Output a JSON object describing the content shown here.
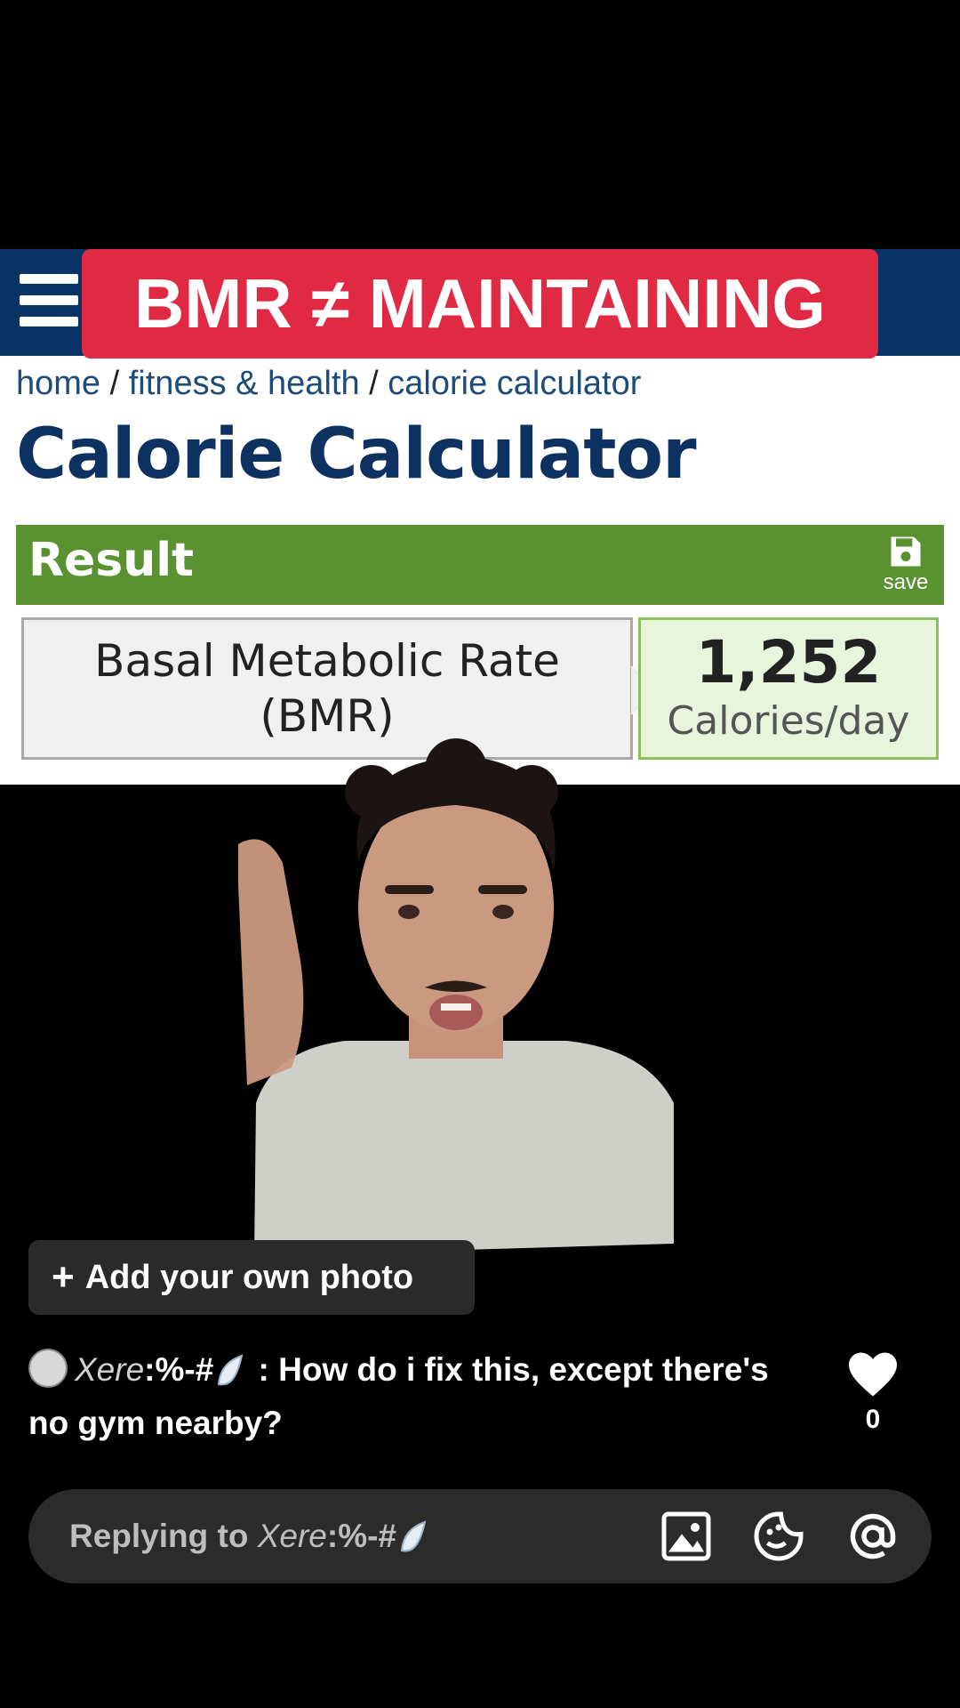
{
  "overlay": {
    "title": "BMR ≠ MAINTAINING"
  },
  "site": {
    "breadcrumb": [
      {
        "label": "home"
      },
      {
        "label": "fitness & health"
      },
      {
        "label": "calorie calculator"
      }
    ],
    "breadcrumb_separator": "/",
    "page_title": "Calorie Calculator",
    "result": {
      "label": "Result",
      "save_label": "save",
      "bmr_label_line1": "Basal Metabolic Rate",
      "bmr_label_line2": "(BMR)",
      "value": "1,252",
      "unit": "Calories/day"
    },
    "colors": {
      "header": "#0b3466",
      "result_bar": "#5a9131",
      "title_overlay": "#e02a43"
    }
  },
  "add_photo": {
    "plus": "+",
    "label": "Add your own photo"
  },
  "comment": {
    "username": "Xere",
    "username_suffix": ":%-#",
    "separator": " : ",
    "text": "How do i fix this, except there's no gym nearby?",
    "like_count": "0"
  },
  "reply": {
    "prefix": "Replying to ",
    "username": "Xere",
    "username_suffix": ":%-#",
    "icons": [
      "image-icon",
      "sticker-icon",
      "mention-icon"
    ]
  }
}
